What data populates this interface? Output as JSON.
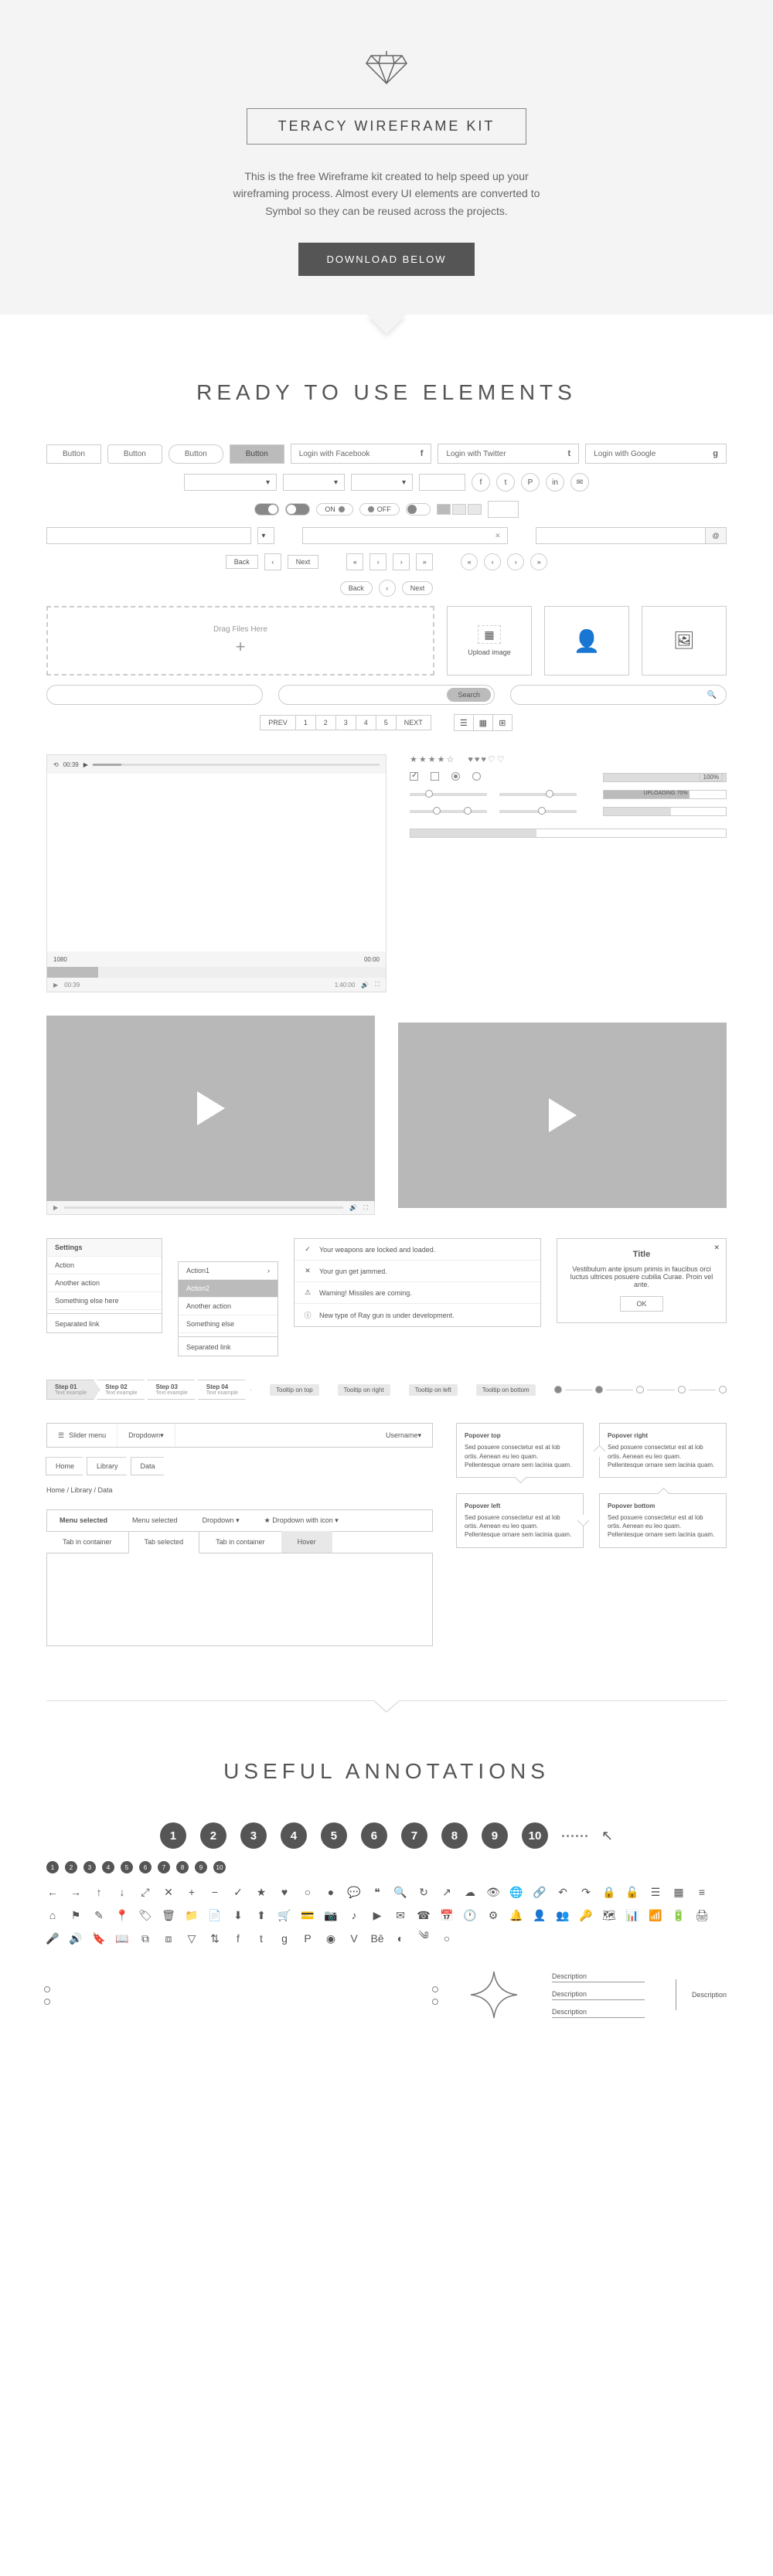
{
  "hero": {
    "title": "TERACY WIREFRAME KIT",
    "intro": "This is the free Wireframe kit created to help speed up your wireframing process. Almost every UI elements are converted to Symbol so they can be reused across the projects.",
    "download": "DOWNLOAD BELOW"
  },
  "sections": {
    "elements": "READY TO USE ELEMENTS",
    "annotations": "USEFUL ANNOTATIONS"
  },
  "buttons": {
    "b1": "Button",
    "b2": "Button",
    "b3": "Button",
    "b4": "Button",
    "fb": "Login with Facebook",
    "fb_i": "f",
    "tw": "Login with Twitter",
    "tw_i": "t",
    "gg": "Login with Google",
    "gg_i": "g"
  },
  "circle_icons": {
    "a": "f",
    "b": "t",
    "c": "P",
    "d": "in",
    "e": "✉"
  },
  "toggles": {
    "on": "ON",
    "off": "OFF"
  },
  "nav": {
    "back": "Back",
    "next": "Next",
    "prev": "PREV",
    "nxt": "NEXT"
  },
  "dropzone": {
    "label": "Drag Files Here",
    "plus": "+"
  },
  "upload": {
    "label": "Upload image"
  },
  "search": {
    "btn": "Search"
  },
  "pages": {
    "p1": "1",
    "p2": "2",
    "p3": "3",
    "p4": "4",
    "p5": "5"
  },
  "video": {
    "time1": "00:39",
    "time2": "1:40:00",
    "vol": "▶",
    "res": "1080",
    "res2": "00:00"
  },
  "progress": {
    "p100": "100%",
    "uploading": "UPLOADING 70%"
  },
  "thumbs": {
    "play": "▶"
  },
  "settings": {
    "header": "Settings",
    "i1": "Action",
    "i2": "Another action",
    "i3": "Something else here",
    "i4": "Separated link"
  },
  "submenu": {
    "i1": "Action1",
    "i2": "Action2",
    "i3": "Another action",
    "i4": "Something else",
    "i5": "Separated link"
  },
  "alerts": {
    "a1": "Your weapons are locked and loaded.",
    "a2": "Your gun get jammed.",
    "a3": "Warning! Missiles are coming.",
    "a4": "New type of Ray gun is under development."
  },
  "modal": {
    "title": "Title",
    "body": "Vestibulum ante ipsum primis in faucibus orci luctus  ultrices posuere cubilia Curae. Proin vel ante.",
    "ok": "OK"
  },
  "steps": {
    "s1t": "Step 01",
    "s1s": "Text example",
    "s2t": "Step 02",
    "s2s": "Text example",
    "s3t": "Step 03",
    "s3s": "Text example",
    "s4t": "Step 04",
    "s4s": "Text example"
  },
  "tags": {
    "t1": "Tooltip on top",
    "t2": "Tooltip on right",
    "t3": "Tooltip on left",
    "t4": "Tooltip on bottom"
  },
  "navbar": {
    "menu": "Slider menu",
    "dd": "Dropdown",
    "user": "Username"
  },
  "crumbs": {
    "c1": "Home",
    "c2": "Library",
    "c3": "Data",
    "text": "Home / Library / Data"
  },
  "popover": {
    "t1": "Popover top",
    "t2": "Popover right",
    "t3": "Popover left",
    "t4": "Popover bottom",
    "body": "Sed posuere consectetur est at lob ortis. Aenean eu leo quam. Pellentesque ornare sem lacinia quam."
  },
  "menubar": {
    "m1": "Menu selected",
    "m2": "Menu selected",
    "m3": "Dropdown",
    "m4": "Dropdown with icon"
  },
  "tabs": {
    "t1": "Tab in container",
    "t2": "Tab selected",
    "t3": "Tab in container",
    "t4": "Hover"
  },
  "numbers": {
    "n1": "1",
    "n2": "2",
    "n3": "3",
    "n4": "4",
    "n5": "5",
    "n6": "6",
    "n7": "7",
    "n8": "8",
    "n9": "9",
    "n10": "10"
  },
  "desc": {
    "d": "Description"
  }
}
